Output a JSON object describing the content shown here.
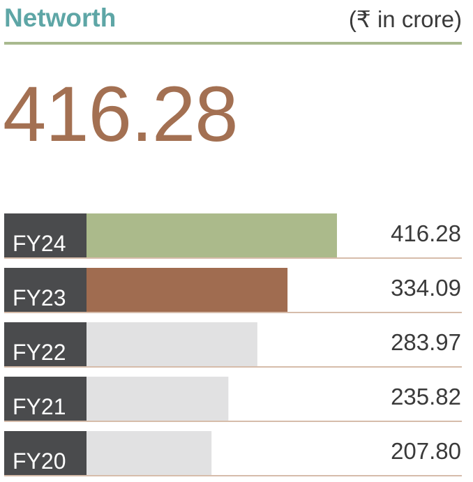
{
  "header": {
    "title": "Networth",
    "unit": "(₹ in crore)"
  },
  "headline_value": "416.28",
  "colors": {
    "title": "#5ea6a6",
    "rule": "#a9b98e",
    "headline": "#a37052",
    "label_bg": "#4a4b4d",
    "fy24_bar": "#abba8b",
    "fy23_bar": "#a06c50",
    "other_bar": "#e1e1e2",
    "row_line": "#c9a58e"
  },
  "chart_data": {
    "type": "bar",
    "orientation": "horizontal",
    "categories": [
      "FY24",
      "FY23",
      "FY22",
      "FY21",
      "FY20"
    ],
    "values": [
      416.28,
      334.09,
      283.97,
      235.82,
      207.8
    ],
    "value_labels": [
      "416.28",
      "334.09",
      "283.97",
      "235.82",
      "207.80"
    ],
    "bar_colors": [
      "#abba8b",
      "#a06c50",
      "#e1e1e2",
      "#e1e1e2",
      "#e1e1e2"
    ],
    "title": "Networth",
    "unit": "(₹ in crore)",
    "xlabel": "",
    "ylabel": "",
    "grid": false,
    "legend": "none"
  }
}
